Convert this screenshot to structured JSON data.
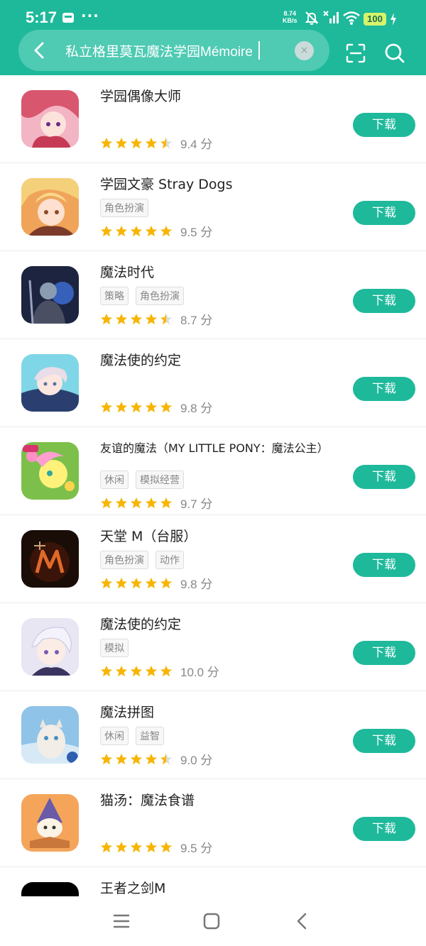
{
  "status": {
    "time": "5:17",
    "more": "···",
    "speed_value": "8.74",
    "speed_unit": "KB/s",
    "battery": "100"
  },
  "search": {
    "query": "私立格里莫瓦魔法学园Mémoire",
    "clear": "×"
  },
  "colors": {
    "accent": "#1db99a",
    "star": "#f7b500"
  },
  "apps": [
    {
      "name": "学园偶像大师",
      "tags": [],
      "rating": "9.4 分",
      "stars": 4.5,
      "button": "下载"
    },
    {
      "name": "学园文豪 Stray Dogs",
      "tags": [
        "角色扮演"
      ],
      "rating": "9.5 分",
      "stars": 5,
      "button": "下载"
    },
    {
      "name": "魔法时代",
      "tags": [
        "策略",
        "角色扮演"
      ],
      "rating": "8.7 分",
      "stars": 4.5,
      "button": "下载"
    },
    {
      "name": "魔法使的约定",
      "tags": [],
      "rating": "9.8 分",
      "stars": 5,
      "button": "下载"
    },
    {
      "name": "友谊的魔法（MY LITTLE PONY：魔法公主）",
      "tags": [
        "休闲",
        "模拟经营"
      ],
      "rating": "9.7 分",
      "stars": 5,
      "button": "下载"
    },
    {
      "name": "天堂 M（台服）",
      "tags": [
        "角色扮演",
        "动作"
      ],
      "rating": "9.8 分",
      "stars": 5,
      "button": "下载"
    },
    {
      "name": "魔法使的约定",
      "tags": [
        "模拟"
      ],
      "rating": "10.0 分",
      "stars": 5,
      "button": "下载"
    },
    {
      "name": "魔法拼图",
      "tags": [
        "休闲",
        "益智"
      ],
      "rating": "9.0 分",
      "stars": 4.5,
      "button": "下载"
    },
    {
      "name": "猫汤：魔法食谱",
      "tags": [],
      "rating": "9.5 分",
      "stars": 5,
      "button": "下载"
    },
    {
      "name": "王者之剑M",
      "tags": [],
      "rating": "",
      "stars": 0,
      "button": ""
    }
  ],
  "icons": {
    "back": "back-arrow-icon",
    "scan": "scan-icon",
    "search": "search-icon",
    "nav_menu": "menu-icon",
    "nav_home": "home-icon",
    "nav_back": "back-icon"
  }
}
